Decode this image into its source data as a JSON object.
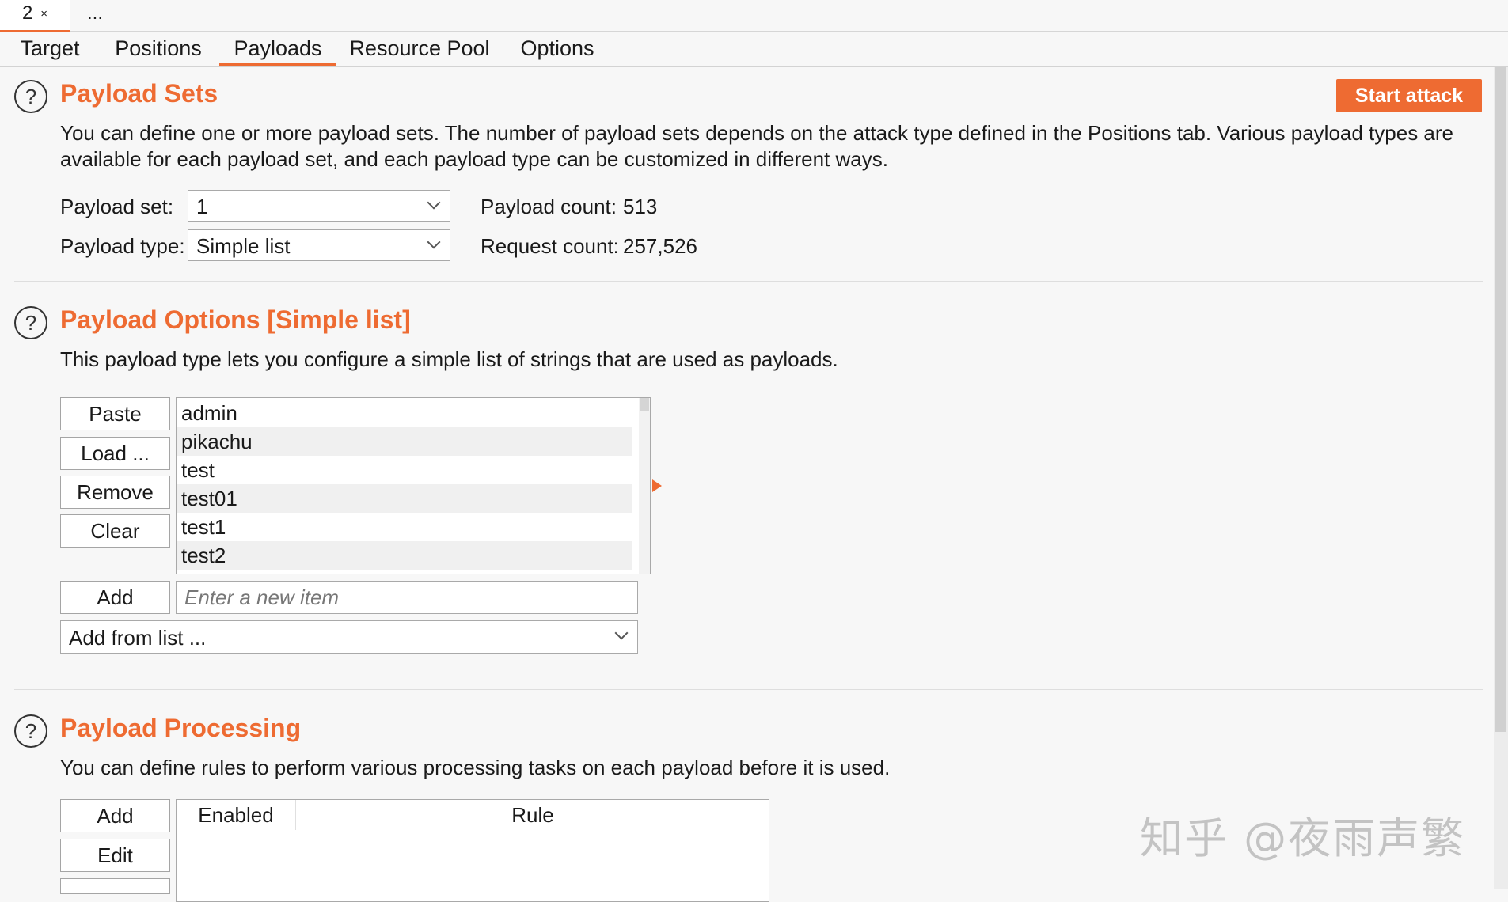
{
  "instance_tabs": [
    {
      "label": "2",
      "close": "×"
    },
    {
      "label": "..."
    }
  ],
  "subtabs": [
    "Target",
    "Positions",
    "Payloads",
    "Resource Pool",
    "Options"
  ],
  "help_glyph": "?",
  "start_attack_label": "Start attack",
  "payload_sets": {
    "title": "Payload Sets",
    "description_line1": "You can define one or more payload sets. The number of payload sets depends on the attack type defined in the Positions tab. Various payload types are",
    "description_line2": "available for each payload set, and each payload type can be customized in different ways.",
    "set_label": "Payload set:",
    "set_value": "1",
    "type_label": "Payload type:",
    "type_value": "Simple list",
    "count_label": "Payload count:",
    "count_value": "513",
    "request_label": "Request count:",
    "request_value": "257,526"
  },
  "payload_options": {
    "title": "Payload Options [Simple list]",
    "description": "This payload type lets you configure a simple list of strings that are used as payloads.",
    "buttons": {
      "paste": "Paste",
      "load": "Load ...",
      "remove": "Remove",
      "clear": "Clear",
      "add": "Add"
    },
    "items": [
      "admin",
      "pikachu",
      "test",
      "test01",
      "test1",
      "test2"
    ],
    "new_item_placeholder": "Enter a new item",
    "add_from_list": "Add from list ..."
  },
  "payload_processing": {
    "title": "Payload Processing",
    "description": "You can define rules to perform various processing tasks on each payload before it is used.",
    "buttons": {
      "add": "Add",
      "edit": "Edit"
    },
    "columns": [
      "Enabled",
      "Rule"
    ]
  },
  "watermark": "知乎 @夜雨声繁",
  "colors": {
    "accent": "#ee6b32",
    "background": "#f7f7f7"
  }
}
